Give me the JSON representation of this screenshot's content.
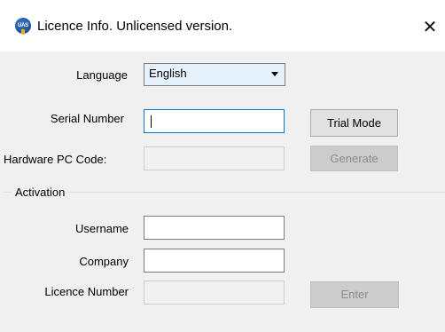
{
  "window": {
    "title": "Licence Info. Unlicensed version.",
    "close_glyph": "✕",
    "app_icon_text": "UAS"
  },
  "form": {
    "language_label": "Language",
    "language_value": "English",
    "serial_label": "Serial Number",
    "serial_value": "",
    "hardware_label": "Hardware PC Code:",
    "hardware_value": "",
    "trial_button": "Trial Mode",
    "generate_button": "Generate"
  },
  "activation": {
    "group_label": "Activation",
    "username_label": "Username",
    "username_value": "",
    "company_label": "Company",
    "company_value": "",
    "licence_label": "Licence Number",
    "licence_value": "",
    "enter_button": "Enter"
  },
  "colors": {
    "accent": "#0078d7",
    "window_bg": "#f0f0f0",
    "titlebar_bg": "#ffffff"
  }
}
